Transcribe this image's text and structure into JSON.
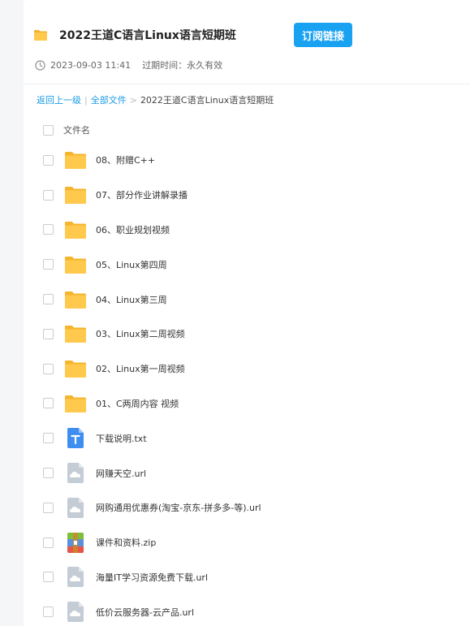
{
  "share": {
    "title": "2022王道C语言Linux语言短期班",
    "subscribe_label": "订阅链接",
    "datetime": "2023-09-03 11:41",
    "expire_label": "过期时间：永久有效"
  },
  "breadcrumb": {
    "back": "返回上一级",
    "sep1": "|",
    "all_files": "全部文件",
    "sep2": ">",
    "current": "2022王道C语言Linux语言短期班"
  },
  "list_header": {
    "name_col": "文件名"
  },
  "files": [
    {
      "name": "08、附赠C++",
      "icon": "folder-icon"
    },
    {
      "name": "07、部分作业讲解录播",
      "icon": "folder-icon"
    },
    {
      "name": "06、职业规划视频",
      "icon": "folder-icon"
    },
    {
      "name": "05、Linux第四周",
      "icon": "folder-icon"
    },
    {
      "name": "04、Linux第三周",
      "icon": "folder-icon"
    },
    {
      "name": "03、Linux第二周视频",
      "icon": "folder-icon"
    },
    {
      "name": "02、Linux第一周视频",
      "icon": "folder-icon"
    },
    {
      "name": "01、C两周内容 视频",
      "icon": "folder-icon"
    },
    {
      "name": "下载说明.txt",
      "icon": "txt-file-icon"
    },
    {
      "name": "网赚天空.url",
      "icon": "url-file-icon"
    },
    {
      "name": "网购通用优惠券(淘宝-京东-拼多多-等).url",
      "icon": "url-file-icon"
    },
    {
      "name": "课件和资料.zip",
      "icon": "zip-file-icon"
    },
    {
      "name": "海量IT学习资源免费下载.url",
      "icon": "url-file-icon"
    },
    {
      "name": "低价云服务器-云产品.url",
      "icon": "url-file-icon"
    }
  ],
  "colors": {
    "accent": "#1aa2f2",
    "link": "#1a9be6",
    "folder": "#ffc94d"
  }
}
